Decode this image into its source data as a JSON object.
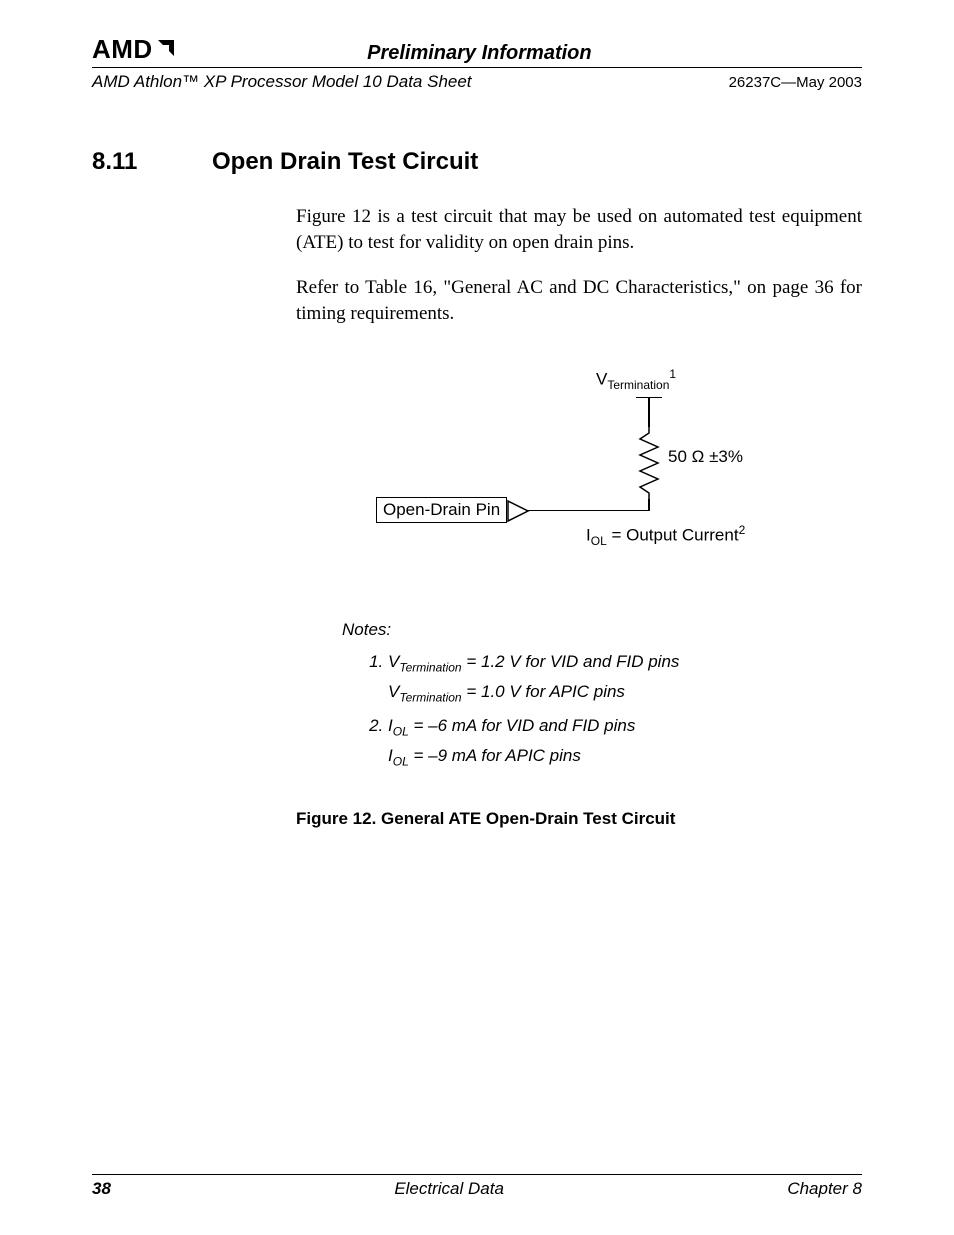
{
  "header": {
    "logo_text": "AMD",
    "preliminary": "Preliminary Information",
    "doc_title": "AMD Athlon™ XP Processor Model 10 Data Sheet",
    "doc_id": "26237C—May 2003"
  },
  "section": {
    "number": "8.11",
    "title": "Open Drain Test Circuit"
  },
  "body": {
    "p1": "Figure 12 is a test circuit that may be used on automated test equipment (ATE) to test for validity on open drain pins.",
    "p2": "Refer to Table 16, \"General AC and DC Characteristics,\" on page 36 for timing requirements."
  },
  "figure": {
    "v_label_prefix": "V",
    "v_label_sub": "Termination",
    "v_label_sup": "1",
    "resistor_value": "50 Ω ±3%",
    "pin_label": "Open-Drain Pin",
    "iol_prefix": "I",
    "iol_sub": "OL",
    "iol_text": " = Output Current",
    "iol_sup": "2"
  },
  "notes": {
    "label": "Notes:",
    "n1_line1_pre": "V",
    "n1_line1_sub": "Termination",
    "n1_line1_rest": " = 1.2 V for VID and FID pins",
    "n1_line2_pre": "V",
    "n1_line2_sub": "Termination",
    "n1_line2_rest": " = 1.0 V for APIC pins",
    "n2_line1_pre": "I",
    "n2_line1_sub": "OL",
    "n2_line1_rest": " = –6 mA for VID and FID pins",
    "n2_line2_pre": "I",
    "n2_line2_sub": "OL",
    "n2_line2_rest": " = –9 mA for APIC pins"
  },
  "caption": "Figure 12.   General ATE Open-Drain Test Circuit",
  "footer": {
    "page": "38",
    "center": "Electrical Data",
    "right": "Chapter 8"
  }
}
